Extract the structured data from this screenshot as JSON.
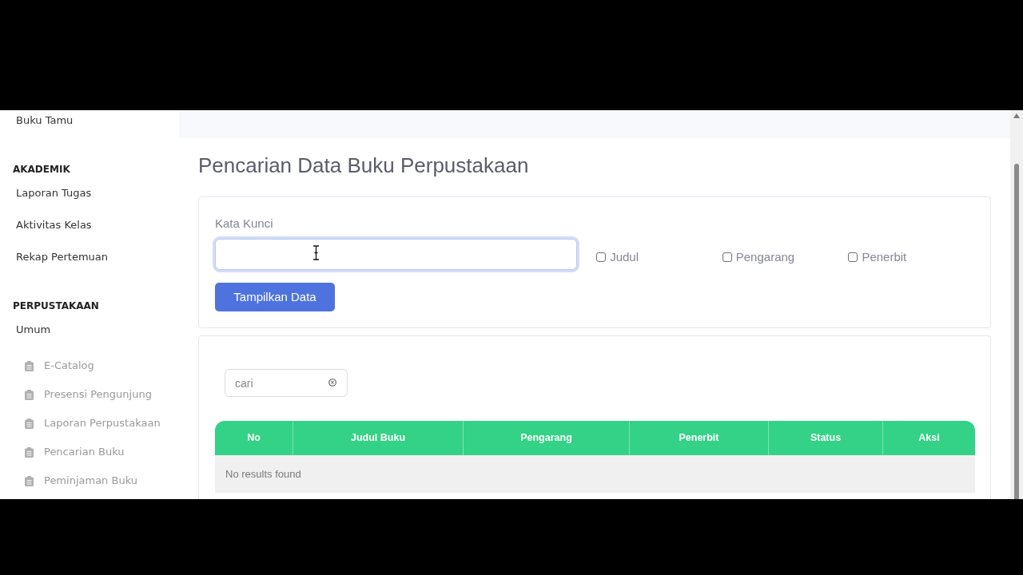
{
  "sidebar": {
    "items": [
      {
        "label": "Buku Tamu"
      }
    ],
    "sections": [
      {
        "heading": "AKADEMIK",
        "items": [
          {
            "label": "Laporan Tugas"
          },
          {
            "label": "Aktivitas Kelas"
          },
          {
            "label": "Rekap Pertemuan"
          }
        ]
      },
      {
        "heading": "PERPUSTAKAAN",
        "items": [
          {
            "label": "Umum",
            "children": [
              {
                "label": "E-Catalog"
              },
              {
                "label": "Presensi Pengunjung"
              },
              {
                "label": "Laporan Perpustakaan"
              },
              {
                "label": "Pencarian Buku"
              },
              {
                "label": "Peminjaman Buku"
              }
            ]
          }
        ]
      }
    ]
  },
  "page_title": "Pencarian Data Buku Perpustakaan",
  "search_form": {
    "label": "Kata Kunci",
    "keyword_field": {
      "focused": true
    },
    "filters": [
      {
        "label": "Judul",
        "checked": false
      },
      {
        "label": "Pengarang",
        "checked": false
      },
      {
        "label": "Penerbit",
        "checked": false
      }
    ],
    "submit_button": "Tampilkan Data"
  },
  "results": {
    "search": {
      "placeholder": "cari"
    },
    "table": {
      "columns": [
        "No",
        "Judul Buku",
        "Pengarang",
        "Penerbit",
        "Status",
        "Aksi"
      ],
      "empty_message": "No results found"
    }
  }
}
